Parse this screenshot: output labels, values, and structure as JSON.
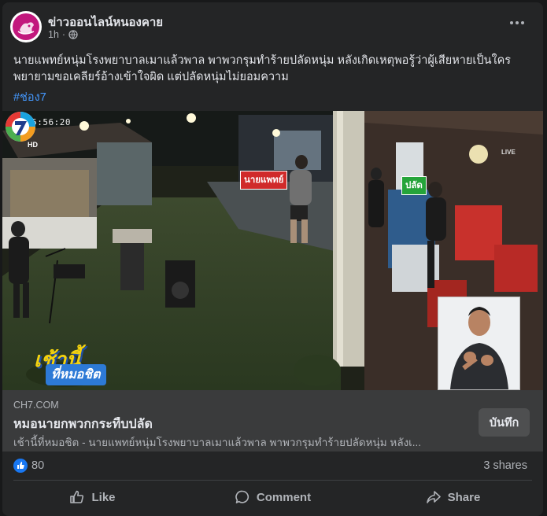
{
  "post": {
    "page_name": "ข่าวออนไลน์หนองคาย",
    "time": "1h",
    "visibility_icon": "globe-icon",
    "caption": "นายแพทย์หนุ่มโรงพยาบาลเมาแล้วพาล พาพวกรุมทำร้ายปลัดหนุ่ม หลังเกิดเหตุพอรู้ว่าผู้เสียหายเป็นใคร พยายามขอเคลียร์อ้างเข้าใจผิด แต่ปลัดหนุ่มไม่ยอมความ",
    "hashtag": "#ช่อง7"
  },
  "video": {
    "timestamp": "05:56:20",
    "tag_doctor": "นายแพทย์",
    "tag_official": "ปลัด",
    "show_title_1": "เช้านี้",
    "show_title_2": "ที่หมอชิต",
    "channel_live": "LIVE"
  },
  "link": {
    "domain": "CH7.COM",
    "title": "หมอนายกพวกกระทืบปลัด",
    "description": "เช้านี้ที่หมอชิต - นายแพทย์หนุ่มโรงพยาบาลเมาแล้วพาล พาพวกรุมทำร้ายปลัดหนุ่ม หลังเ...",
    "save_label": "บันทึก"
  },
  "stats": {
    "likes": "80",
    "shares": "3 shares"
  },
  "actions": {
    "like": "Like",
    "comment": "Comment",
    "share": "Share"
  },
  "colors": {
    "background": "#18191a",
    "card": "#242526",
    "link_bar": "#3a3b3c",
    "accent": "#1877f2",
    "hashtag": "#4599ff"
  }
}
